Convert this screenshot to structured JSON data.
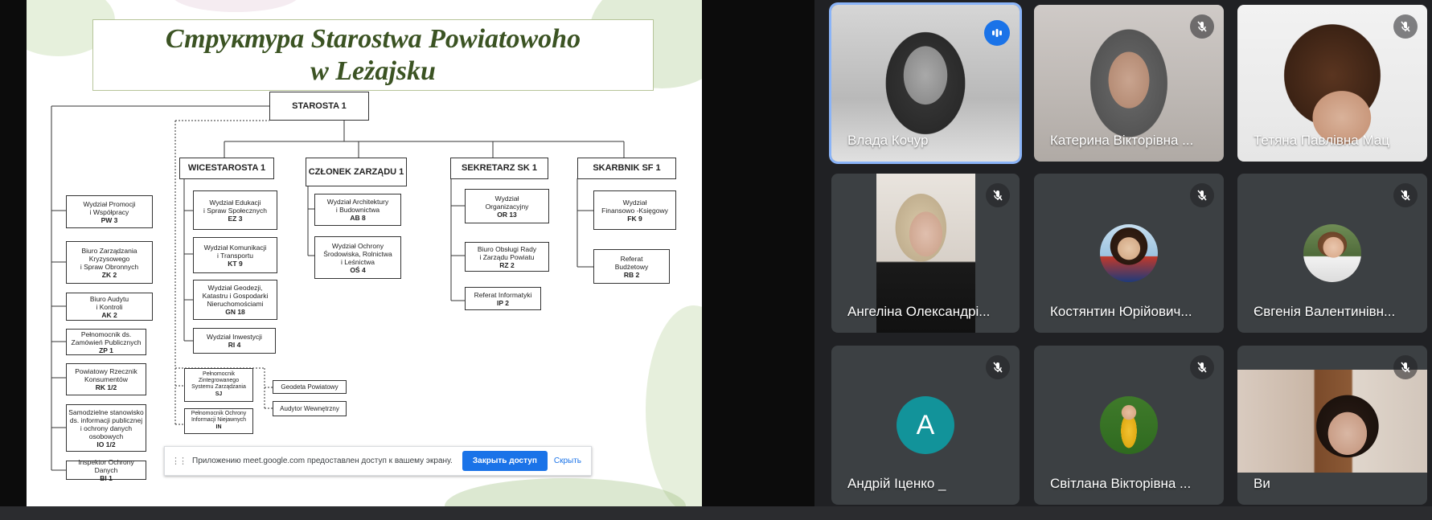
{
  "slide": {
    "title_line1": "Структура Starostwa Powiatowoho",
    "title_line2": "w Leżajsku",
    "starosta": "STAROSTA 1",
    "headers": {
      "wicestarosta": "WICESTAROSTA 1",
      "czlonek": "CZŁONEK ZARZĄDU 1",
      "sekretarz": "SEKRETARZ  SK  1",
      "skarbnik": "SKARBNIK  SF 1"
    },
    "left_units": [
      {
        "name": "Wydział Promocji\ni Współpracy",
        "code": "PW 3"
      },
      {
        "name": "Biuro Zarządzania\nKryzysowego\ni Spraw Obronnych",
        "code": "ZK 2"
      },
      {
        "name": "Biuro Audytu\ni Kontroli",
        "code": "AK 2"
      },
      {
        "name": "Pełnomocnik ds.\nZamówień Publicznych",
        "code": "ZP 1"
      },
      {
        "name": "Powiatowy Rzecznik\nKonsumentów",
        "code": "RK 1/2"
      },
      {
        "name": "Samodzielne stanowisko\nds. informacji publicznej\ni ochrony danych\nosobowych",
        "code": "IO 1/2"
      },
      {
        "name": "Inspektor Ochrony Danych",
        "code": "BI 1"
      }
    ],
    "wice_units": [
      {
        "name": "Wydział Edukacji\ni Spraw Społecznych",
        "code": "EZ 3"
      },
      {
        "name": "Wydział Komunikacji\ni Transportu",
        "code": "KT 9"
      },
      {
        "name": "Wydział Geodezji,\nKatastru i Gospodarki\nNieruchomościami",
        "code": "GN 18"
      },
      {
        "name": "Wydział Inwestycji",
        "code": "RI 4"
      }
    ],
    "czlonek_units": [
      {
        "name": "Wydział Architektury\ni Budownictwa",
        "code": "AB 8"
      },
      {
        "name": "Wydział Ochrony\nŚrodowiska, Rolnictwa\ni Leśnictwa",
        "code": "OŚ 4"
      }
    ],
    "sekretarz_units": [
      {
        "name": "Wydział\nOrganizacyjny",
        "code": "OR 13"
      },
      {
        "name": "Biuro Obsługi Rady\ni Zarządu Powiatu",
        "code": "RZ 2"
      },
      {
        "name": "Referat Informatyki",
        "code": "IP 2"
      }
    ],
    "skarbnik_units": [
      {
        "name": "Wydział\nFinansowo -Księgowy",
        "code": "FK 9"
      },
      {
        "name": "Referat\nBudżetowy",
        "code": "RB 2"
      }
    ],
    "dotted_units": [
      {
        "name": "Pełnomocnik\nZintegrowanego\nSystemu Zarządzania",
        "code": "SJ"
      },
      {
        "name": "Pełnomocnik Ochrony\nInformacji Niejawnych",
        "code": "IN"
      }
    ],
    "side_units": [
      "Geodeta Powiatowy",
      "Audytor Wewnętrzny"
    ]
  },
  "share_bar": {
    "text": "Приложению meet.google.com предоставлен доступ к вашему экрану.",
    "stop_label": "Закрыть доступ",
    "hide_label": "Скрыть"
  },
  "participants": [
    {
      "name": "Влада Кочур",
      "state": "speaking",
      "icon": "audio-level-icon"
    },
    {
      "name": "Катерина Вікторівна ...",
      "state": "muted",
      "icon": "mic-off-icon"
    },
    {
      "name": "Тетяна Павлівна Мац",
      "state": "muted",
      "icon": "mic-off-icon"
    },
    {
      "name": "Ангеліна Олександрі...",
      "state": "muted",
      "icon": "mic-off-icon"
    },
    {
      "name": "Костянтин Юрійович...",
      "state": "muted",
      "icon": "mic-off-icon"
    },
    {
      "name": "Євгенія Валентинівн...",
      "state": "muted",
      "icon": "mic-off-icon"
    },
    {
      "name": "Андрій Іценко _",
      "state": "muted",
      "icon": "mic-off-icon",
      "avatar_letter": "A"
    },
    {
      "name": "Світлана Вікторівна ...",
      "state": "muted",
      "icon": "mic-off-icon"
    },
    {
      "name": "Ви",
      "state": "muted",
      "icon": "mic-off-icon"
    }
  ],
  "colors": {
    "accent": "#1a73e8",
    "speaking_border": "#8ab4f8",
    "tile_bg": "#3c4043",
    "title_green": "#3b5323",
    "avatar_teal": "#12939a"
  }
}
